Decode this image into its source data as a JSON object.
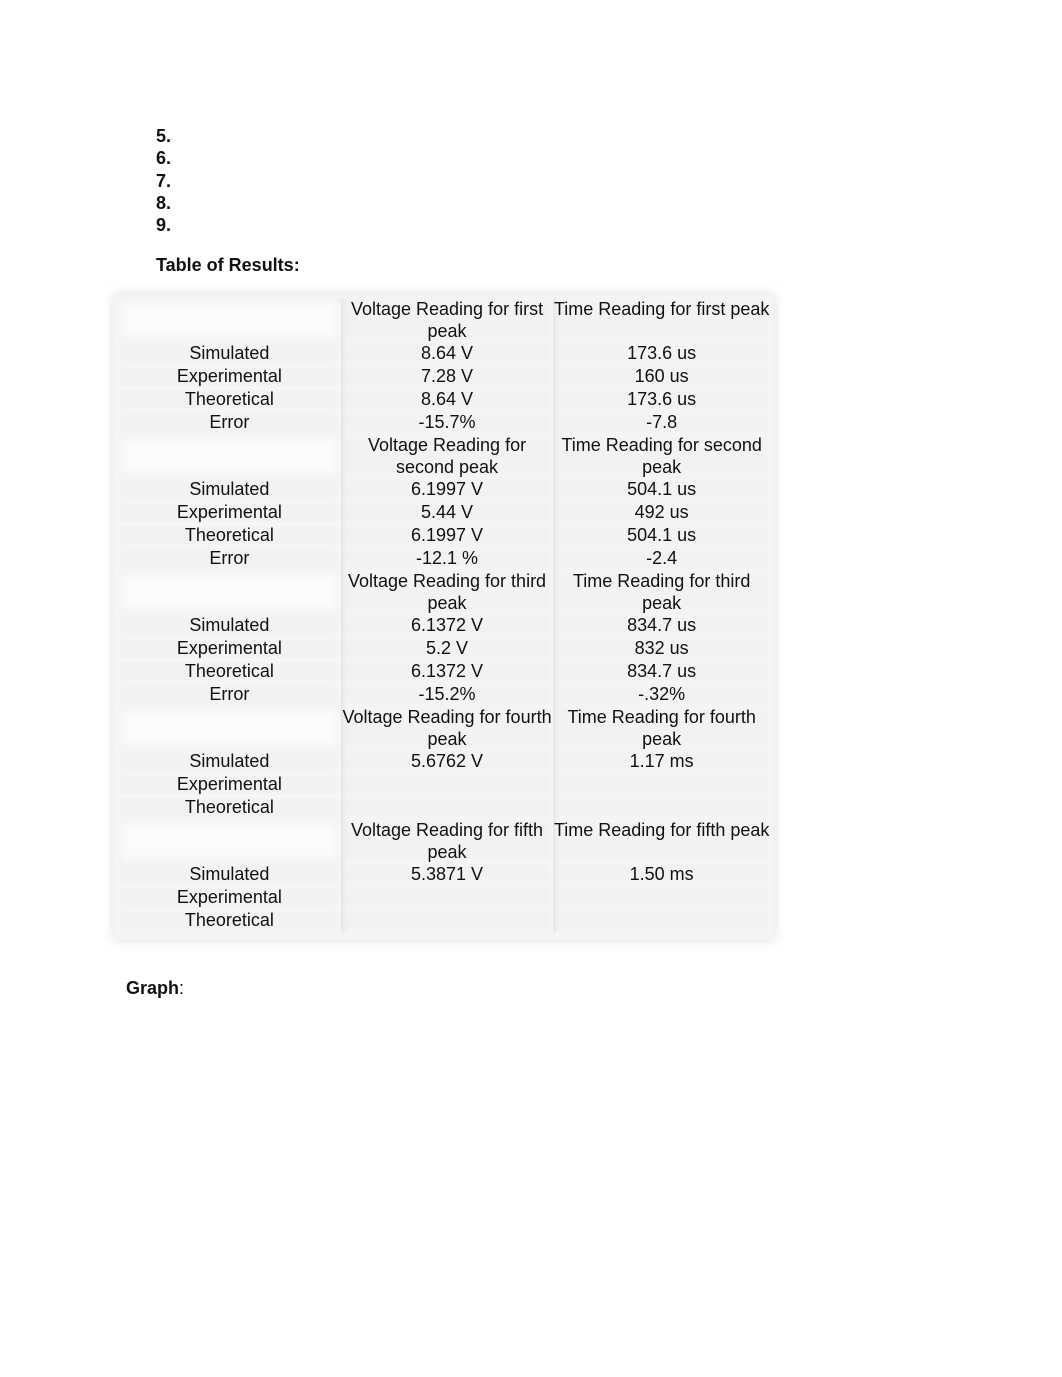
{
  "list_items": [
    "5.",
    "6.",
    "7.",
    "8.",
    "9."
  ],
  "table_heading": "Table of Results:",
  "graph_heading": {
    "label": "Graph",
    "colon": ":"
  },
  "results_table": {
    "sections": [
      {
        "headers": [
          "",
          "Voltage Reading for first peak",
          "Time Reading for first peak"
        ],
        "rows": [
          [
            "Simulated",
            "8.64 V",
            "173.6 us"
          ],
          [
            "Experimental",
            "7.28 V",
            "160 us"
          ],
          [
            "Theoretical",
            "8.64 V",
            "173.6 us"
          ],
          [
            "Error",
            "-15.7%",
            "-7.8"
          ]
        ]
      },
      {
        "headers": [
          "",
          "Voltage Reading for second peak",
          "Time Reading for second peak"
        ],
        "rows": [
          [
            "Simulated",
            "6.1997 V",
            "504.1 us"
          ],
          [
            "Experimental",
            "5.44 V",
            "492 us"
          ],
          [
            "Theoretical",
            "6.1997 V",
            "504.1 us"
          ],
          [
            "Error",
            "-12.1 %",
            "-2.4"
          ]
        ]
      },
      {
        "headers": [
          "",
          "Voltage Reading for third peak",
          "Time Reading for third peak"
        ],
        "rows": [
          [
            "Simulated",
            "6.1372 V",
            "834.7 us"
          ],
          [
            "Experimental",
            "5.2 V",
            "832 us"
          ],
          [
            "Theoretical",
            "6.1372 V",
            "834.7 us"
          ],
          [
            "Error",
            "-15.2%",
            "-.32%"
          ]
        ]
      },
      {
        "headers": [
          "",
          "Voltage Reading for fourth peak",
          "Time Reading for fourth peak"
        ],
        "rows": [
          [
            "Simulated",
            "5.6762 V",
            "1.17 ms"
          ],
          [
            "Experimental",
            "",
            ""
          ],
          [
            "Theoretical",
            "",
            ""
          ]
        ]
      },
      {
        "headers": [
          "",
          "Voltage Reading for fifth peak",
          "Time Reading for fifth peak"
        ],
        "rows": [
          [
            "Simulated",
            "5.3871 V",
            "1.50 ms"
          ],
          [
            "Experimental",
            "",
            ""
          ],
          [
            "Theoretical",
            "",
            ""
          ]
        ]
      }
    ]
  }
}
